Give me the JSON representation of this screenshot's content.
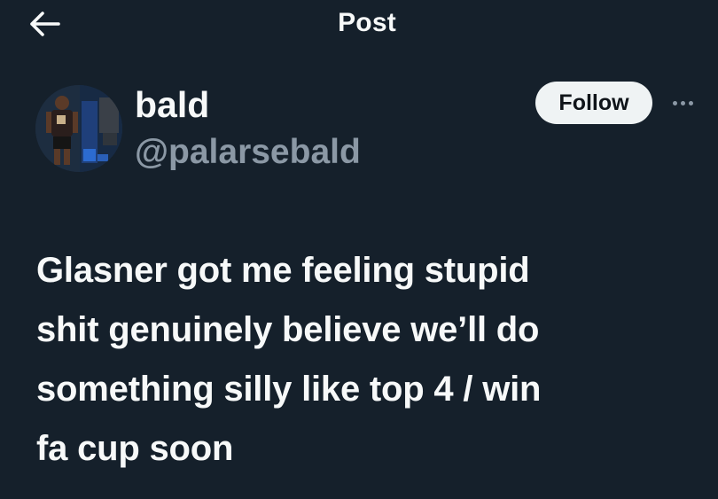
{
  "header": {
    "title": "Post",
    "back_icon": "arrow-left-icon"
  },
  "author": {
    "display_name": "bald",
    "handle": "@palarsebald",
    "avatar_icon": "user-avatar-photo"
  },
  "actions": {
    "follow_label": "Follow",
    "more_icon": "more-horizontal-icon"
  },
  "post": {
    "text": "Glasner got me feeling stupid\nshit genuinely believe we’ll do\nsomething silly like top 4 / win\nfa cup soon"
  },
  "colors": {
    "background": "#15202b",
    "text_primary": "#f7f9f9",
    "text_secondary": "#8b98a5",
    "follow_bg": "#eff3f4",
    "follow_text": "#0f1419"
  }
}
